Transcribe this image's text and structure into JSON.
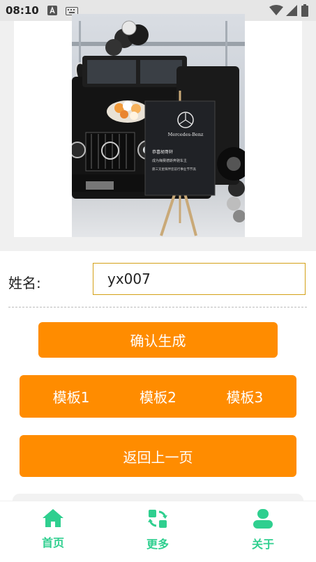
{
  "status_bar": {
    "time": "08:10",
    "icons": [
      "a-notification-icon",
      "keyboard-icon",
      "wifi-icon",
      "signal-icon",
      "battery-icon"
    ]
  },
  "preview": {
    "board_brand": "Mercedes-Benz",
    "board_line1": "恭喜胡哥轩",
    "board_line2": "成为梅赛德斯奔驰车主",
    "board_line3": "愿三叉星辉伴您前行事业节节高"
  },
  "form": {
    "name_label": "姓名:",
    "name_value": "yx007"
  },
  "buttons": {
    "confirm": "确认生成",
    "templates": [
      "模板1",
      "模板2",
      "模板3"
    ],
    "back": "返回上一页"
  },
  "nav": {
    "items": [
      {
        "label": "首页",
        "icon": "home-icon"
      },
      {
        "label": "更多",
        "icon": "refresh-icon"
      },
      {
        "label": "关于",
        "icon": "user-icon"
      }
    ]
  },
  "colors": {
    "accent": "#ff8c00",
    "nav_active": "#2fcf8f",
    "input_border": "#d4a017"
  }
}
